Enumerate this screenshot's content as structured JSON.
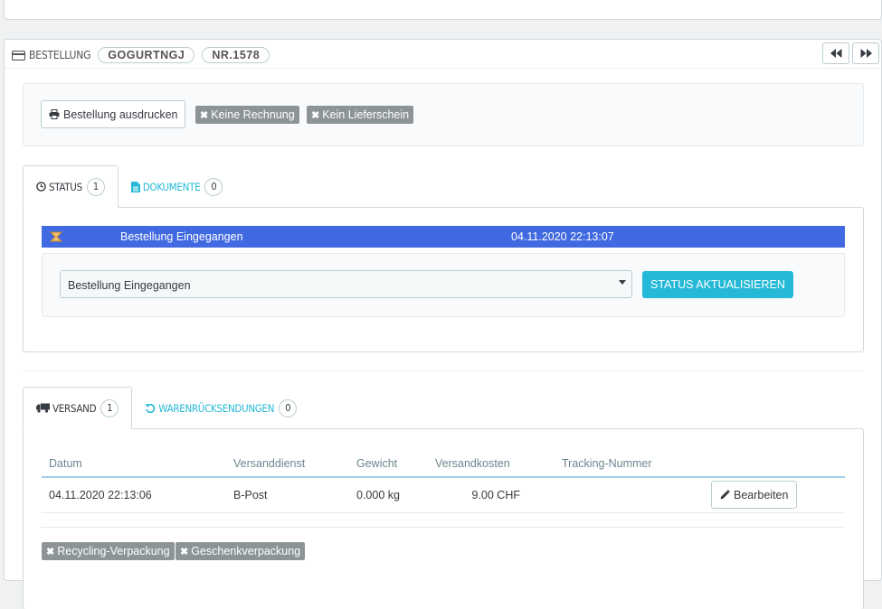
{
  "order_panel": {
    "title": "BESTELLUNG",
    "reference": "GOGURTNGJ",
    "number": "NR.1578",
    "icon": "credit-card-icon"
  },
  "nav": {
    "prev_icon": "fast-backward-icon",
    "next_icon": "fast-forward-icon"
  },
  "actions": {
    "print_label": "Bestellung ausdrucken",
    "no_invoice": "Keine Rechnung",
    "no_delivery_slip": "Kein Lieferschein"
  },
  "status_tabs": [
    {
      "label": "STATUS",
      "count": "1",
      "icon": "clock-icon"
    },
    {
      "label": "DOKUMENTE",
      "count": "0",
      "icon": "file-icon"
    }
  ],
  "status_history": {
    "row": {
      "name": "Bestellung Eingegangen",
      "date": "04.11.2020 22:13:07",
      "color": "#4169e1"
    }
  },
  "status_form": {
    "selected": "Bestellung Eingegangen",
    "button": "STATUS AKTUALISIEREN"
  },
  "shipping_tabs": [
    {
      "label": "VERSAND",
      "count": "1",
      "icon": "truck-icon"
    },
    {
      "label": "WARENRÜCKSENDUNGEN",
      "count": "0",
      "icon": "undo-icon"
    }
  ],
  "shipping_table": {
    "headers": [
      "Datum",
      "Versanddienst",
      "Gewicht",
      "Versandkosten",
      "Tracking-Nummer"
    ],
    "row": {
      "date": "04.11.2020 22:13:06",
      "carrier": "B-Post",
      "weight": "0.000 kg",
      "cost": "9.00 CHF",
      "tracking": ""
    },
    "edit_label": "Bearbeiten"
  },
  "options": {
    "recycling": "Recycling-Verpackung",
    "gift": "Geschenkverpackung"
  },
  "colors": {
    "accent": "#25b9d7",
    "status_blue": "#4169e1",
    "tag_gray": "#8c9498"
  }
}
